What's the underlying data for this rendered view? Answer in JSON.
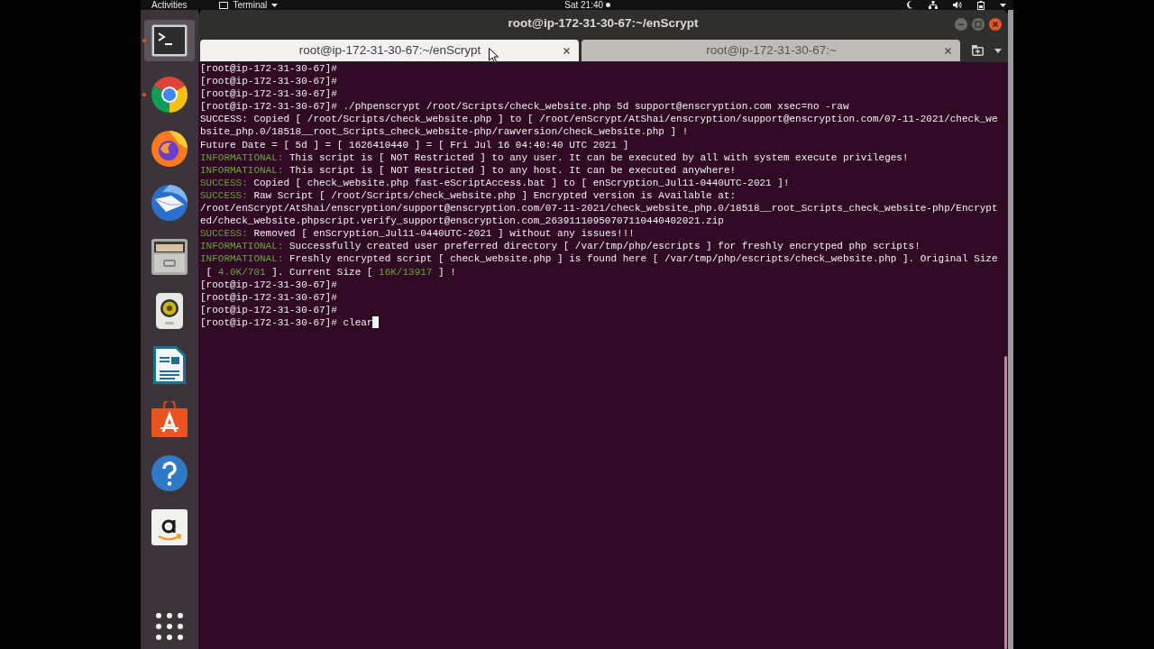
{
  "top_bar": {
    "activities": "Activities",
    "app_menu": "Terminal",
    "clock": "Sat 21:40"
  },
  "dock": {
    "items": [
      {
        "kind": "terminal",
        "running": true,
        "selected": true
      },
      {
        "kind": "ring-browser",
        "running": true,
        "selected": false
      },
      {
        "kind": "globe-browser",
        "running": false,
        "selected": false
      },
      {
        "kind": "mail",
        "running": false,
        "selected": false
      },
      {
        "kind": "files",
        "running": false,
        "selected": false
      },
      {
        "kind": "speaker",
        "running": false,
        "selected": false
      },
      {
        "kind": "document",
        "running": false,
        "selected": false
      },
      {
        "kind": "bag",
        "running": false,
        "selected": false
      },
      {
        "kind": "help",
        "running": false,
        "selected": false
      },
      {
        "kind": "store",
        "running": false,
        "selected": false
      }
    ]
  },
  "window": {
    "title": "root@ip-172-31-30-67:~/enScrypt"
  },
  "tabs": [
    {
      "label": "root@ip-172-31-30-67:~/enScrypt",
      "selected": true
    },
    {
      "label": "root@ip-172-31-30-67:~",
      "selected": false
    }
  ],
  "terminal": {
    "cursor": true,
    "lines": [
      [
        {
          "text": "[root@ip-172-31-30-67]#"
        }
      ],
      [
        {
          "text": "[root@ip-172-31-30-67]#"
        }
      ],
      [
        {
          "text": "[root@ip-172-31-30-67]#"
        }
      ],
      [
        {
          "text": "[root@ip-172-31-30-67]# ./phpenscrypt /root/Scripts/check_website.php 5d support@enscryption.com xsec=no -raw"
        }
      ],
      [
        {
          "text": "SUCCESS: Copied [ /root/Scripts/check_website.php ] to [ /root/enScrypt/AtShai/enscryption/support@enscryption.com/07-11-2021/check_we"
        }
      ],
      [
        {
          "text": "bsite_php.0/18518__root_Scripts_check_website-php/rawversion/check_website.php ] !"
        }
      ],
      [
        {
          "text": "Future Date = [ 5d ] = [ 1626410440 ] = [ Fri Jul 16 04:40:40 UTC 2021 ]"
        }
      ],
      [
        {
          "text": "INFORMATIONAL:",
          "color": "#6aa33a"
        },
        {
          "text": " This script is [ NOT Restricted ] to any user. It can be executed by all with system execute privileges!"
        }
      ],
      [
        {
          "text": "INFORMATIONAL:",
          "color": "#6aa33a"
        },
        {
          "text": " This script is [ NOT Restricted ] to any host. It can be executed anywhere!"
        }
      ],
      [
        {
          "text": "SUCCESS:",
          "color": "#6aa33a"
        },
        {
          "text": " Copied [ check_website.php fast-eScriptAccess.bat ] to [ enScryption_Jul11-0440UTC-2021 ]!"
        }
      ],
      [
        {
          "text": "SUCCESS:",
          "color": "#6aa33a"
        },
        {
          "text": " Raw Script [ /root/Scripts/check_website.php ] Encrypted version is Available at:"
        }
      ],
      [
        {
          "text": "/root/enScrypt/AtShai/enscryption/support@enscryption.com/07-11-2021/check_website_php.0/18518__root_Scripts_check_website-php/Encrypt"
        }
      ],
      [
        {
          "text": "ed/check_website.phpscript.verify_support@enscryption.com_26391110950707110440402021.zip"
        }
      ],
      [
        {
          "text": "SUCCESS:",
          "color": "#6aa33a"
        },
        {
          "text": " Removed [ enScryption_Jul11-0440UTC-2021 ] without any issues!!!"
        }
      ],
      [
        {
          "text": "INFORMATIONAL:",
          "color": "#6aa33a"
        },
        {
          "text": " Successfully created user preferred directory [ /var/tmp/php/escripts ] for freshly encrytped php scripts!"
        }
      ],
      [
        {
          "text": "INFORMATIONAL:",
          "color": "#6aa33a"
        },
        {
          "text": " Freshly encrypted script [ check_website.php ] is found here [ /var/tmp/php/escripts/check_website.php ]. Original Size"
        }
      ],
      [
        {
          "text": " [ "
        },
        {
          "text": "4.0K/701",
          "color": "#6aa33a"
        },
        {
          "text": " ]. Current Size [ "
        },
        {
          "text": "16K/13917",
          "color": "#6aa33a"
        },
        {
          "text": " ] !"
        }
      ],
      [
        {
          "text": "[root@ip-172-31-30-67]#"
        }
      ],
      [
        {
          "text": "[root@ip-172-31-30-67]#"
        }
      ],
      [
        {
          "text": "[root@ip-172-31-30-67]#"
        }
      ],
      [
        {
          "text": "[root@ip-172-31-30-67]# clear"
        }
      ]
    ]
  }
}
